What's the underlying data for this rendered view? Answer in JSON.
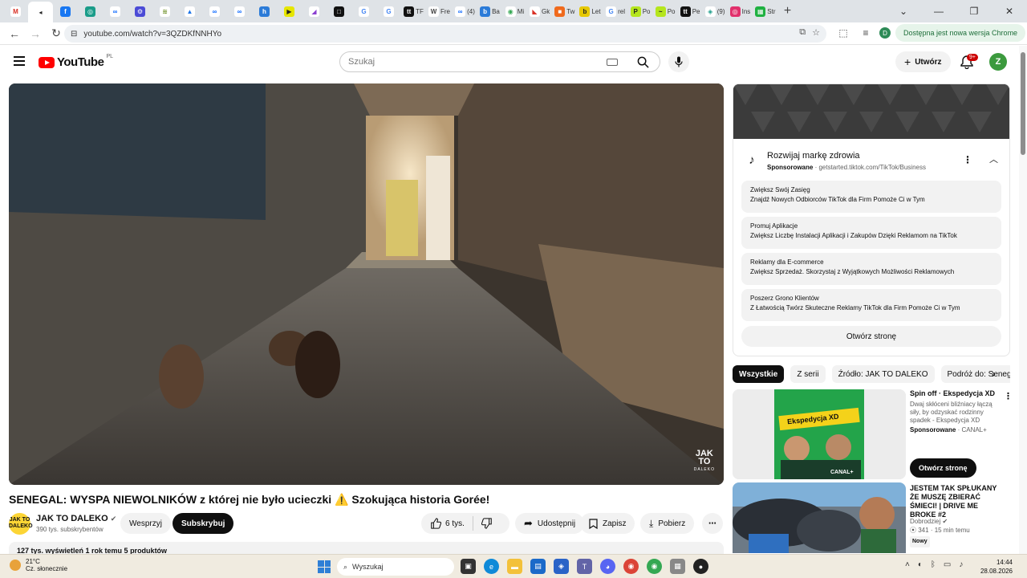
{
  "browser": {
    "tabs": [
      {
        "favicon": "M",
        "color": "#ffffff",
        "fg": "#d93025",
        "label": ""
      },
      {
        "favicon": "◂",
        "color": "#ffffff",
        "fg": "#222",
        "label": "",
        "active": true
      },
      {
        "favicon": "f",
        "color": "#1877f2",
        "label": ""
      },
      {
        "favicon": "◎",
        "color": "#1a9c89",
        "label": ""
      },
      {
        "favicon": "∞",
        "color": "#ffffff",
        "fg": "#0866ff",
        "label": ""
      },
      {
        "favicon": "⚙",
        "color": "#4b4bd6",
        "label": ""
      },
      {
        "favicon": "≋",
        "color": "#ffffff",
        "fg": "#6b8e23",
        "label": ""
      },
      {
        "favicon": "▲",
        "color": "#ffffff",
        "fg": "#1a73e8",
        "label": ""
      },
      {
        "favicon": "∞",
        "color": "#ffffff",
        "fg": "#0866ff",
        "label": ""
      },
      {
        "favicon": "∞",
        "color": "#ffffff",
        "fg": "#0866ff",
        "label": ""
      },
      {
        "favicon": "h",
        "color": "#2b7bd8",
        "label": ""
      },
      {
        "favicon": "▶",
        "color": "#e6e600",
        "fg": "#222",
        "label": ""
      },
      {
        "favicon": "◢",
        "color": "#ffffff",
        "fg": "#8a3fd1",
        "label": ""
      },
      {
        "favicon": "□",
        "color": "#111111",
        "label": ""
      },
      {
        "favicon": "G",
        "color": "#ffffff",
        "fg": "#4285f4",
        "label": ""
      },
      {
        "favicon": "G",
        "color": "#ffffff",
        "fg": "#4285f4",
        "label": ""
      },
      {
        "favicon": "tt",
        "color": "#111111",
        "label": "TF"
      },
      {
        "favicon": "W",
        "color": "#ffffff",
        "fg": "#444",
        "label": "Fre"
      },
      {
        "favicon": "∞",
        "color": "#ffffff",
        "fg": "#0866ff",
        "label": "(4)"
      },
      {
        "favicon": "b",
        "color": "#2b7bd8",
        "label": "Ba"
      },
      {
        "favicon": "◉",
        "color": "#ffffff",
        "fg": "#34a853",
        "label": "Mi"
      },
      {
        "favicon": "◣",
        "color": "#ffffff",
        "fg": "#d93025",
        "label": "Gk"
      },
      {
        "favicon": "■",
        "color": "#f06a1d",
        "label": "Tw"
      },
      {
        "favicon": "b",
        "color": "#e6c800",
        "fg": "#222",
        "label": "Let"
      },
      {
        "favicon": "G",
        "color": "#ffffff",
        "fg": "#4285f4",
        "label": "rel"
      },
      {
        "favicon": "P",
        "color": "#b5e61d",
        "fg": "#222",
        "label": "Po"
      },
      {
        "favicon": "~",
        "color": "#b5e61d",
        "fg": "#222",
        "label": "Po"
      },
      {
        "favicon": "tt",
        "color": "#111111",
        "label": "Pe"
      },
      {
        "favicon": "◈",
        "color": "#ffffff",
        "fg": "#1a9c89",
        "label": "(9)"
      },
      {
        "favicon": "◎",
        "color": "#e1306c",
        "label": "Ins"
      },
      {
        "favicon": "▦",
        "color": "#1fb141",
        "label": "Str"
      }
    ],
    "url": "youtube.com/watch?v=3QZDKfNNHYo",
    "update_text": "Dostępna jest nowa wersja Chrome"
  },
  "youtube": {
    "logo_text": "YouTube",
    "country_code": "PL",
    "search_placeholder": "Szukaj",
    "create_label": "Utwórz",
    "notif_count": "9+",
    "avatar_letter": "Z"
  },
  "video": {
    "title": "SENEGAL: WYSPA NIEWOLNIKÓW z której nie było ucieczki ⚠️ Szokująca historia Gorée!",
    "watermark_line1": "JAK",
    "watermark_line2": "TO",
    "watermark_line3": "DALEKO",
    "channel_name": "JAK TO DALEKO",
    "channel_avatar_text": "JAK TO DALEKO",
    "subscribers": "390 tys. subskrybentów",
    "support_label": "Wesprzyj",
    "subscribe_label": "Subskrybuj",
    "likes": "6 tys.",
    "share_label": "Udostępnij",
    "save_label": "Zapisz",
    "download_label": "Pobierz",
    "description_stats": "127 tys. wyświetleń  1 rok temu  5 produktów"
  },
  "ad": {
    "title": "Rozwijaj markę zdrowia",
    "sponsored": "Sponsorowane",
    "domain": "getstarted.tiktok.com/TikTok/Business",
    "items": [
      {
        "title": "Zwiększ Swój Zasięg",
        "desc": "Znajdź Nowych Odbiorców TikTok dla Firm Pomoże Ci w Tym"
      },
      {
        "title": "Promuj Aplikacje",
        "desc": "Zwiększ Liczbę Instalacji Aplikacji i Zakupów Dzięki Reklamom na TikTok"
      },
      {
        "title": "Reklamy dla E-commerce",
        "desc": "Zwiększ Sprzedaż. Skorzystaj z Wyjątkowych Możliwości Reklamowych"
      },
      {
        "title": "Poszerz Grono Klientów",
        "desc": "Z Łatwością Twórz Skuteczne Reklamy TikTok dla Firm Pomoże Ci w Tym"
      }
    ],
    "open_label": "Otwórz stronę"
  },
  "chips": [
    "Wszystkie",
    "Z serii",
    "Źródło: JAK TO DALEKO",
    "Podróż do: Senegal"
  ],
  "recommendations": [
    {
      "title": "Spin off · Ekspedycja XD",
      "desc": "Dwaj skłóceni bliźniacy łączą siły, by odzyskać rodzinny spadek - Ekspedycja XD",
      "sponsored": "Sponsorowane",
      "channel": "CANAL+",
      "cta": "Otwórz stronę",
      "thumb_text": "Ekspedycja XD",
      "thumb_brand": "CANAL+"
    },
    {
      "title": "JESTEM TAK SPŁUKANY ŻE MUSZĘ ZBIERAĆ ŚMIECI! | DRIVE ME BROKE #2",
      "channel": "Dobrodziej",
      "views": "341",
      "duration": "15 min temu",
      "badge": "Nowy"
    }
  ],
  "taskbar": {
    "temperature": "21°C",
    "weather": "Cz. słonecznie",
    "search": "Wyszukaj",
    "time": "14:44",
    "date": "28.08.2026"
  }
}
